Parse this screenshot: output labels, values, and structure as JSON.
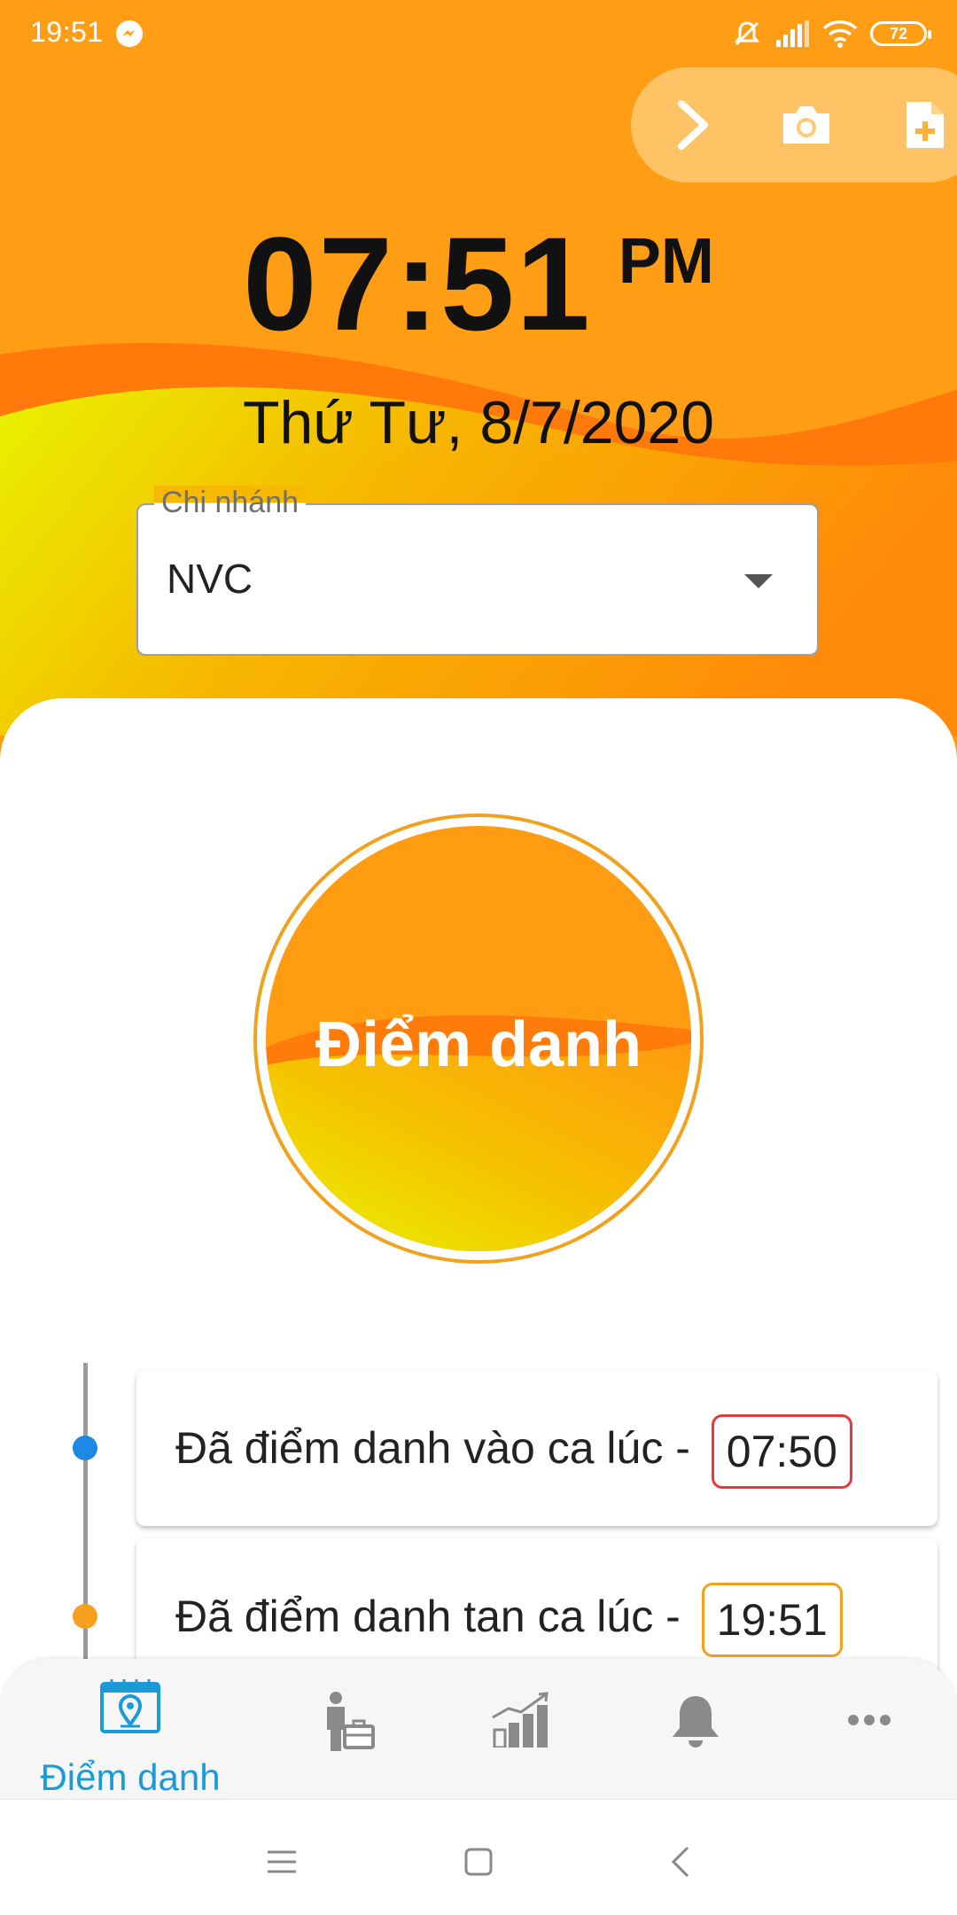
{
  "status_bar": {
    "time": "19:51",
    "battery": "72"
  },
  "clock": {
    "time": "07:51",
    "ampm": "PM",
    "date": "Thứ Tư, 8/7/2020"
  },
  "branch": {
    "label": "Chi nhánh",
    "value": "NVC"
  },
  "checkin": {
    "label": "Điểm danh"
  },
  "logs": [
    {
      "text": "Đã điểm danh vào ca lúc -",
      "time": "07:50",
      "accent": "#e5393b",
      "dot": "#1e88e5"
    },
    {
      "text": "Đã điểm danh tan ca lúc -",
      "time": "19:51",
      "accent": "#f2a11c",
      "dot": "#f5a01f"
    }
  ],
  "bottom_nav": {
    "items": [
      {
        "icon": "calendar-location-icon",
        "label": "Điểm danh",
        "active": true
      },
      {
        "icon": "employee-briefcase-icon"
      },
      {
        "icon": "chart-growth-icon"
      },
      {
        "icon": "bell-icon"
      },
      {
        "icon": "more-icon"
      }
    ]
  },
  "colors": {
    "accent": "#1a9ad6",
    "orange": "#ff9d12",
    "yellow": "#e9f200"
  }
}
